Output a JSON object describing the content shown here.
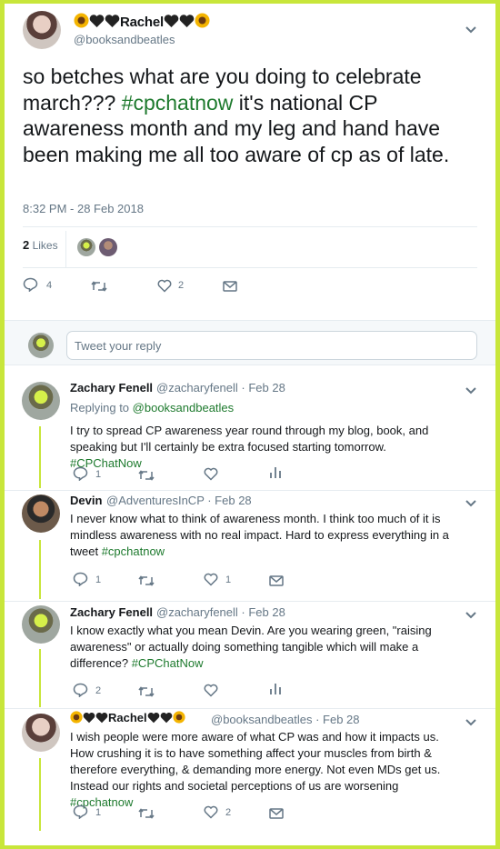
{
  "main_tweet": {
    "display_name": "Rachel",
    "handle": "@booksandbeatles",
    "text_plain_1": "so betches what are you doing to celebrate march??? ",
    "hashtag": "#cpchatnow",
    "text_plain_2": " it's national CP awareness month and my leg and hand have been making me all too aware of cp as of late.",
    "timestamp": "8:32 PM - 28 Feb 2018",
    "likes_count": "2",
    "likes_label": "Likes",
    "reply_count": "4",
    "like_count": "2"
  },
  "reply_box": {
    "placeholder": "Tweet your reply"
  },
  "replies": [
    {
      "name": "Zachary Fenell",
      "meta": "@zacharyfenell · Feb 28",
      "replying_label": "Replying to ",
      "replying_to": "@booksandbeatles",
      "text": "I try to spread CP awareness year round through my blog, book, and speaking but I'll certainly be extra focused starting tomorrow. ",
      "hashtag": "#CPChatNow",
      "reply_count": "1",
      "like_count": ""
    },
    {
      "name": "Devin",
      "meta": "@AdventuresInCP · Feb 28",
      "text": "I never know what to think of awareness month. I think too much of it is mindless awareness with no real impact. Hard to express everything in a tweet ",
      "hashtag": "#cpchatnow",
      "reply_count": "1",
      "like_count": "1"
    },
    {
      "name": "Zachary Fenell",
      "meta": "@zacharyfenell · Feb 28",
      "text": "I know exactly what you mean Devin. Are you wearing green, \"raising awareness\" or actually doing something tangible which will make a difference? ",
      "hashtag": "#CPChatNow",
      "reply_count": "2",
      "like_count": ""
    },
    {
      "name": "Rachel",
      "meta": "@booksandbeatles · Feb 28",
      "text": "I wish people were more aware of what CP was and how it impacts us. How crushing it is to have something affect your muscles from birth & therefore everything, & demanding more energy. Not even MDs get us. Instead our rights and societal perceptions of us are worsening ",
      "hashtag": "#cpchatnow",
      "reply_count": "1",
      "like_count": "2"
    }
  ],
  "colors": {
    "hashtag": "#1e7a2e",
    "frame": "#c8e63a",
    "muted": "#657786"
  },
  "icons": [
    "chevron-down-icon",
    "reply-icon",
    "retweet-icon",
    "heart-icon",
    "mail-icon",
    "analytics-icon",
    "sunflower-icon",
    "black-heart-icon"
  ]
}
